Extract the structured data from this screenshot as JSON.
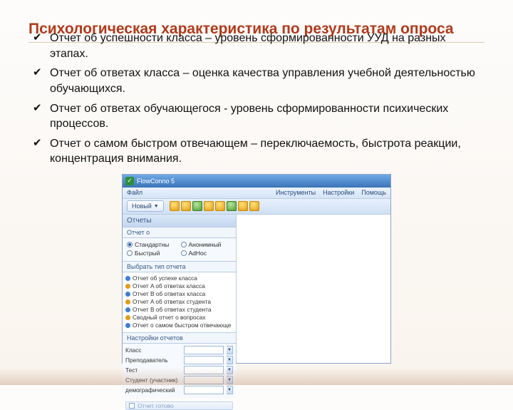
{
  "title": "Психологическая характеристика по результатам опроса",
  "bullets": [
    "Отчет об успешности  класса – уровень сформированности УУД на разных этапах.",
    "Отчет об ответах класса – оценка качества управления учебной деятельностью обучающихся.",
    "Отчет об ответах обучающегося - уровень сформированности психических процессов.",
    "Отчет о самом быстром отвечающем – переключаемость, быстрота реакции, концентрация внимания."
  ],
  "app": {
    "window_title": "FlowConno 5",
    "menu": {
      "file": "Файл",
      "tools": "Инструменты",
      "settings": "Настройки",
      "help": "Помощь"
    },
    "toolbar": {
      "new_label": "Новый"
    },
    "sidebar": {
      "panel_title": "Отчеты",
      "report_on": "Отчет о",
      "radios": {
        "standard": "Стандартны",
        "adhoc": "AdHoc",
        "fast": "Быстрый",
        "anonymous": "Анонимный"
      },
      "select_type": "Выбрать тип отчета",
      "types": [
        "Отчет об успехе класса",
        "Отчет A об ответах класса",
        "Отчет B об ответах класса",
        "Отчет A об ответах студента",
        "Отчет B об ответах студента",
        "Сводный отчет о вопросах",
        "Отчет о самом быстром отвечающе"
      ],
      "settings_title": "Настройки отчетов",
      "settings_rows": {
        "class": "Класс",
        "teacher": "Преподаватель",
        "test": "Тест",
        "student": "Студент (участник)",
        "demographic": "демографический"
      },
      "bottom_button": "Отчет готово"
    }
  }
}
